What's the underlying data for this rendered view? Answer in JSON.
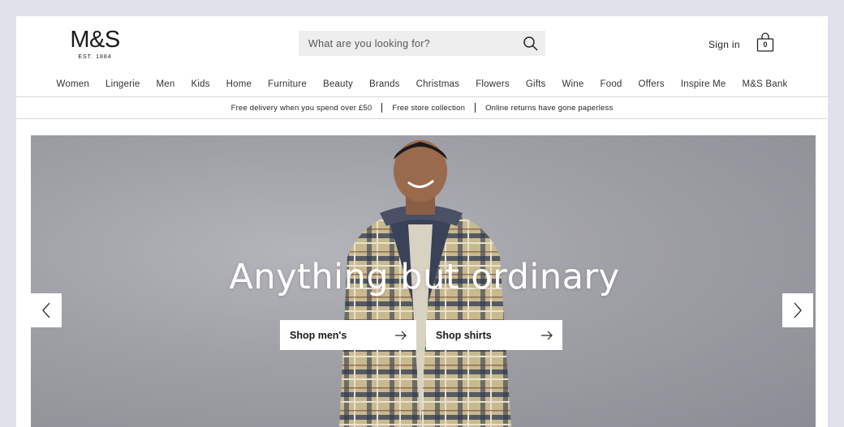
{
  "header": {
    "logo_main": "M&S",
    "logo_sub": "EST. 1884",
    "search_placeholder": "What are you looking for?",
    "sign_in": "Sign in",
    "bag_count": "0"
  },
  "nav": {
    "items": [
      "Women",
      "Lingerie",
      "Men",
      "Kids",
      "Home",
      "Furniture",
      "Beauty",
      "Brands",
      "Christmas",
      "Flowers",
      "Gifts",
      "Wine",
      "Food",
      "Offers",
      "Inspire Me",
      "M&S Bank"
    ]
  },
  "promo": {
    "items": [
      "Free delivery when you spend over £50",
      "Free store collection",
      "Online returns have gone paperless"
    ]
  },
  "hero": {
    "title": "Anything but ordinary",
    "buttons": [
      "Shop men's",
      "Shop shirts"
    ]
  },
  "icons": {
    "search": "search-icon",
    "bag": "shopping-bag-icon",
    "arrow": "arrow-right-icon",
    "prev": "chevron-left-icon",
    "next": "chevron-right-icon"
  }
}
